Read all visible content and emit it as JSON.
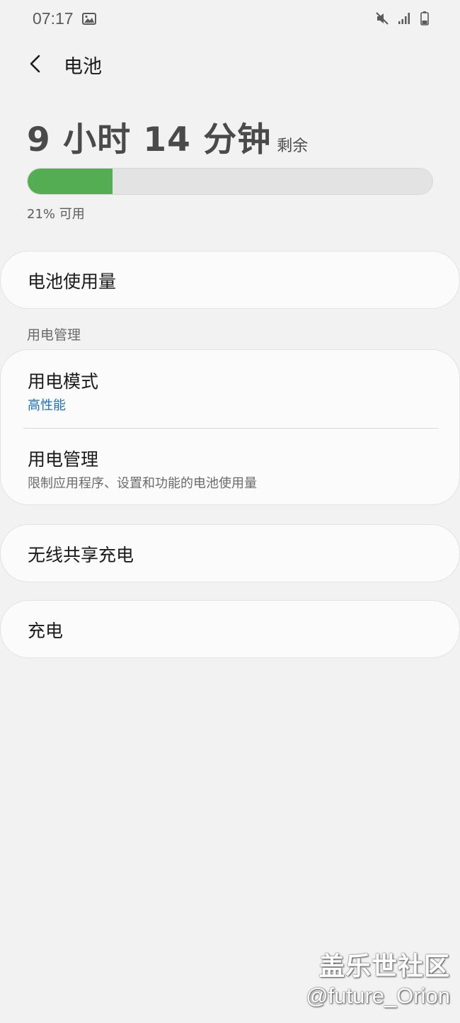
{
  "status_bar": {
    "time": "07:17",
    "icons": [
      "image-icon",
      "mute-icon",
      "signal-icon",
      "battery-icon"
    ]
  },
  "header": {
    "title": "电池",
    "back_icon": "back-arrow-icon"
  },
  "battery": {
    "time_remaining": "9 小时 14 分钟",
    "remaining_label": "剩余",
    "percent": 21,
    "available_text": "21% 可用",
    "fill_color": "#55ad53"
  },
  "items": {
    "usage": "电池使用量",
    "section_power": "用电管理",
    "power_mode": {
      "title": "用电模式",
      "value": "高性能",
      "value_color": "#1f6fb5"
    },
    "power_management": {
      "title": "用电管理",
      "subtitle": "限制应用程序、设置和功能的电池使用量"
    },
    "wireless_share": "无线共享充电",
    "charging": "充电"
  },
  "watermark": {
    "community": "盖乐世社区",
    "handle": "@future_Orion"
  }
}
